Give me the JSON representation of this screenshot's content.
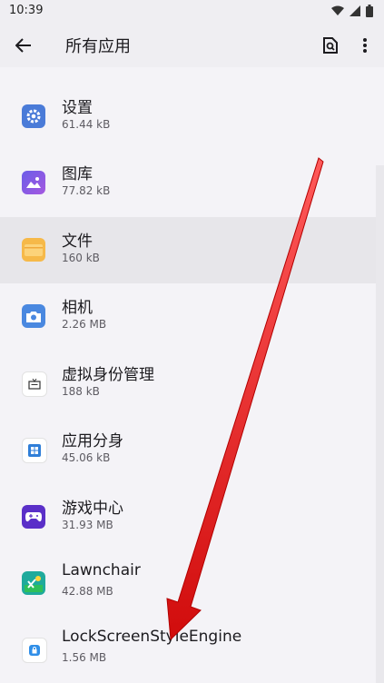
{
  "status": {
    "time": "10:39"
  },
  "header": {
    "title": "所有应用"
  },
  "apps": [
    {
      "name": "设置",
      "size": "61.44 kB"
    },
    {
      "name": "图库",
      "size": "77.82 kB"
    },
    {
      "name": "文件",
      "size": "160 kB"
    },
    {
      "name": "相机",
      "size": "2.26 MB"
    },
    {
      "name": "虚拟身份管理",
      "size": "188 kB"
    },
    {
      "name": "应用分身",
      "size": "45.06 kB"
    },
    {
      "name": "游戏中心",
      "size": "31.93 MB"
    },
    {
      "name": "Lawnchair",
      "size": "42.88 MB"
    },
    {
      "name": "LockScreenStyleEngine",
      "size": "1.56 MB"
    }
  ],
  "colors": {
    "accent": "#4a7bd8",
    "arrow": "#e01414"
  }
}
